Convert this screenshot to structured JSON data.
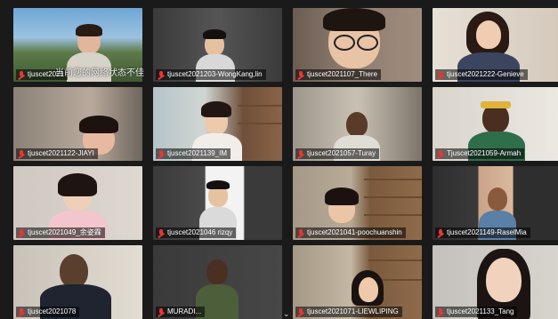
{
  "network_warning": "当前您的网络状态不佳",
  "chevron_icon": "chevron-down-icon",
  "participants": [
    {
      "name": "tjuscet2021",
      "key": "p1"
    },
    {
      "name": "tjuscet2021203-WongKang,lin",
      "key": "p2"
    },
    {
      "name": "tjuscet2021107_There",
      "key": "p3"
    },
    {
      "name": "tjuscet2021222-Genieve",
      "key": "p4"
    },
    {
      "name": "tjuscet2021122-JIAYI",
      "key": "p5"
    },
    {
      "name": "tjuscet2021139_IM",
      "key": "p6"
    },
    {
      "name": "tjuscet2021057-Turay",
      "key": "p7"
    },
    {
      "name": "Tjuscet2021059-Armah",
      "key": "p8"
    },
    {
      "name": "tjuscet2021049_余姿霖",
      "key": "p9"
    },
    {
      "name": "tjuscet2021046 rizqy",
      "key": "p10"
    },
    {
      "name": "tjuscet2021041-poochuanshin",
      "key": "p11"
    },
    {
      "name": "tjuscet2021149-RaselMia",
      "key": "p12"
    },
    {
      "name": "tjuscet2021078",
      "key": "p13"
    },
    {
      "name": "MURADI...",
      "key": "p14"
    },
    {
      "name": "tjuscet2021071-LIEWLIPING",
      "key": "p15"
    },
    {
      "name": "tjuscet2021133_Tang",
      "key": "p16"
    }
  ]
}
